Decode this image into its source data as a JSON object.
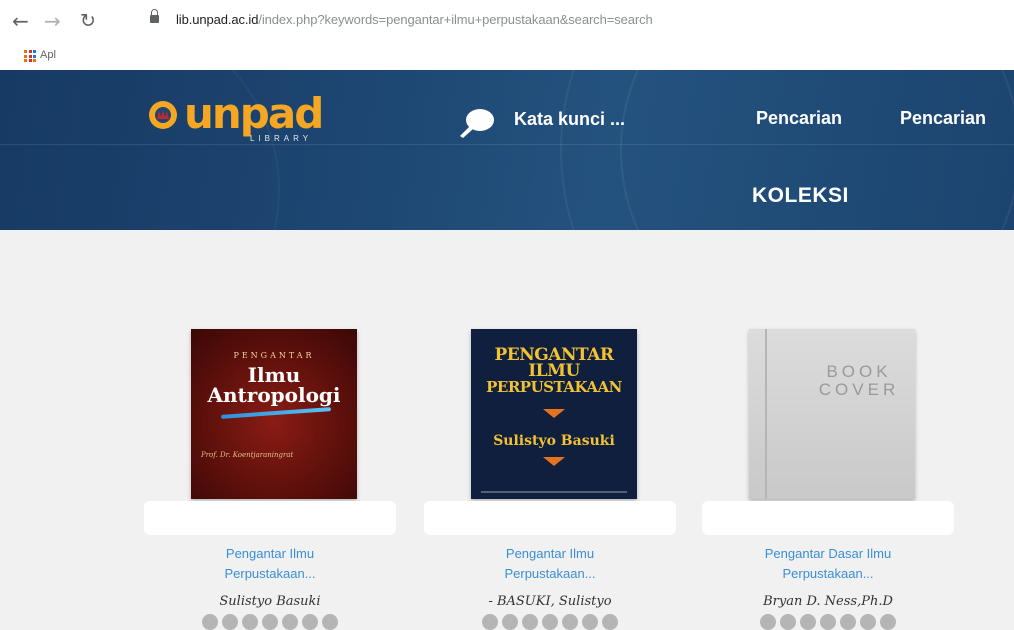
{
  "browser": {
    "url_host": "lib.unpad.ac.id",
    "url_path": "/index.php?keywords=pengantar+ilmu+perpustakaan&search=search",
    "bookmark_apps_label": "Apl"
  },
  "header": {
    "logo_word": "unpad",
    "logo_sub": "LIBRARY",
    "search_placeholder": "Kata kunci ...",
    "nav": [
      "Pencarian",
      "Pencarian"
    ],
    "section_title": "KOLEKSI"
  },
  "books": [
    {
      "title_line1": "Pengantar Ilmu",
      "title_line2": "Perpustakaan...",
      "author": "Sulistyo Basuki",
      "cover": {
        "top": "PENGANTAR",
        "title1": "Ilmu",
        "title2": "Antropologi",
        "author": "Prof. Dr. Koentjaraningrat"
      }
    },
    {
      "title_line1": "Pengantar Ilmu",
      "title_line2": "Perpustakaan...",
      "author": "- BASUKI, Sulistyo",
      "cover": {
        "line1": "PENGANTAR",
        "line2": "ILMU",
        "line3": "PERPUSTAKAAN",
        "author": "Sulistyo Basuki"
      }
    },
    {
      "title_line1": "Pengantar Dasar Ilmu",
      "title_line2": "Perpustakaan...",
      "author": "Bryan D. Ness,Ph.D",
      "cover": {
        "line1": "BOOK",
        "line2": "COVER"
      }
    }
  ],
  "colors": {
    "header_bg": "#1d4672",
    "logo": "#f5a623",
    "link": "#3a8ed6"
  }
}
